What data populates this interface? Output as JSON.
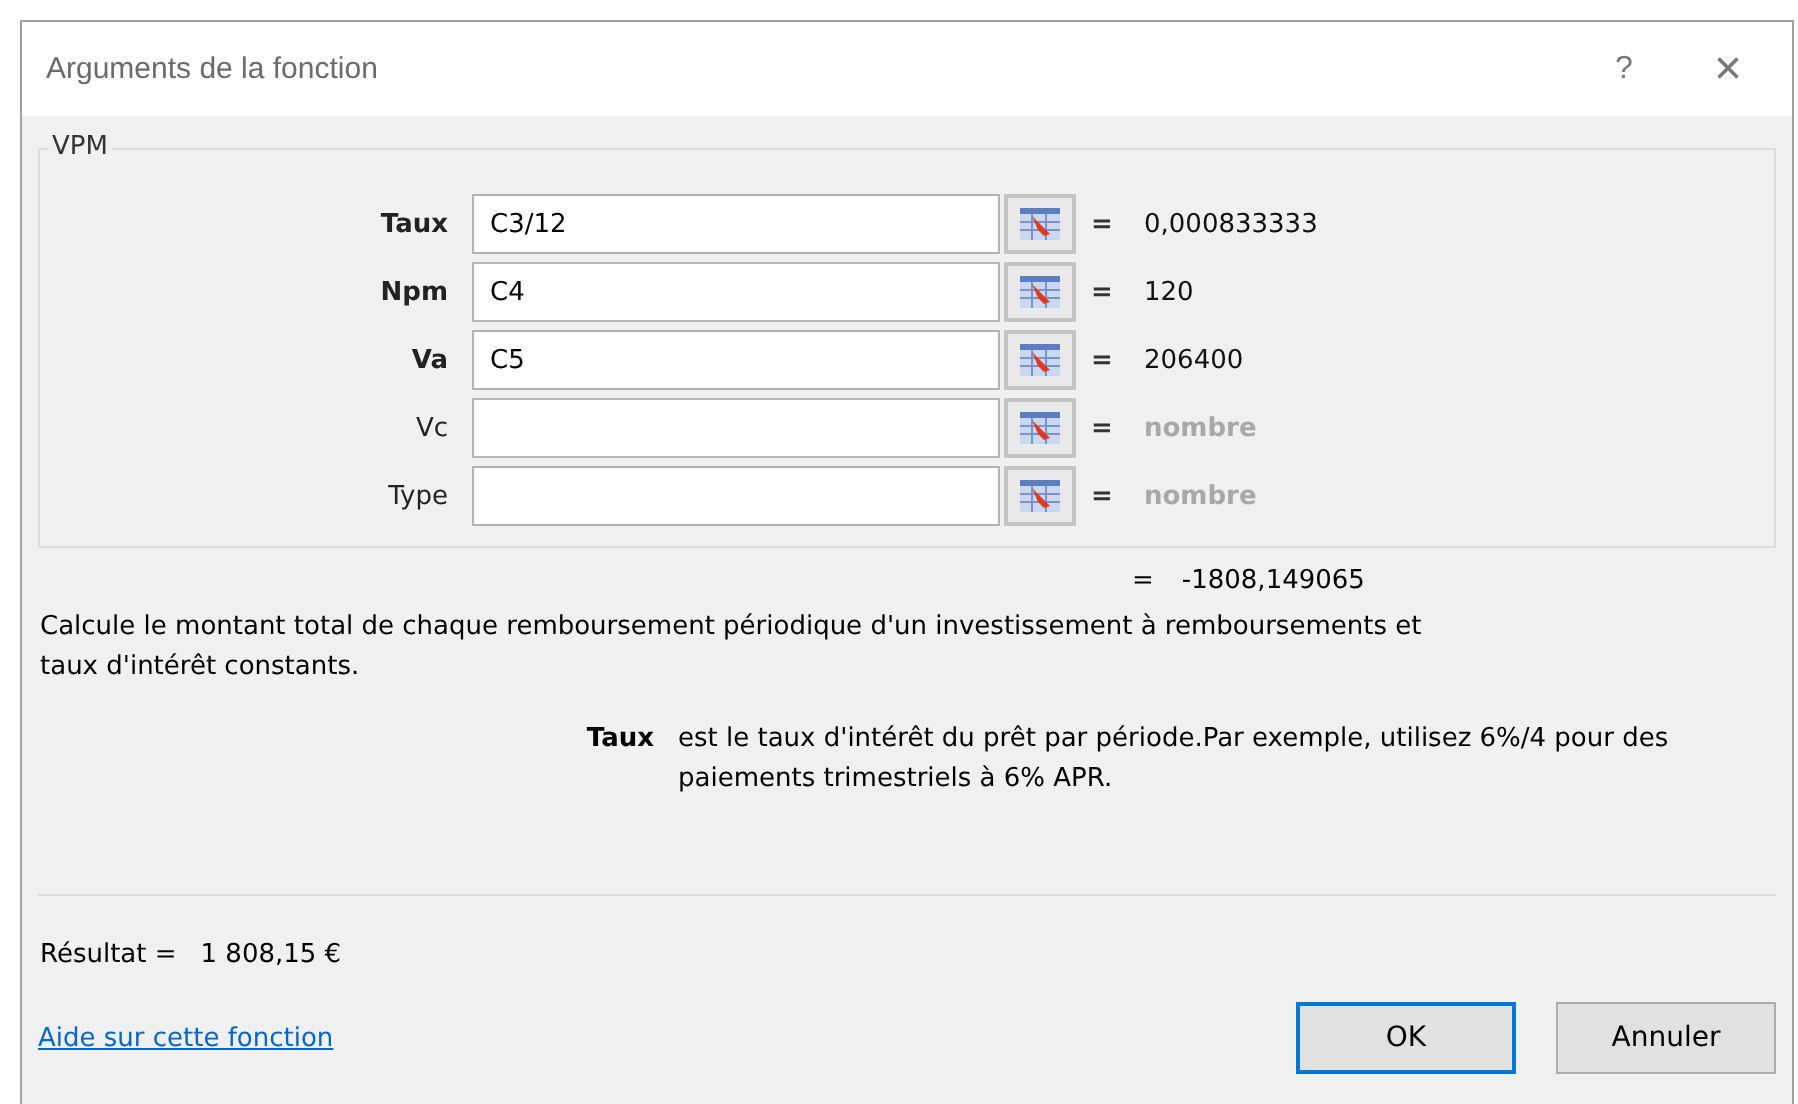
{
  "window": {
    "title": "Arguments de la fonction",
    "help_button": "?",
    "close_button": "×"
  },
  "function_group": {
    "name": "VPM",
    "arguments": [
      {
        "label": "Taux",
        "required": true,
        "value": "C3/12",
        "equals": "=",
        "result": "0,000833333",
        "result_muted": false
      },
      {
        "label": "Npm",
        "required": true,
        "value": "C4",
        "equals": "=",
        "result": "120",
        "result_muted": false
      },
      {
        "label": "Va",
        "required": true,
        "value": "C5",
        "equals": "=",
        "result": "206400",
        "result_muted": false
      },
      {
        "label": "Vc",
        "required": false,
        "equals": "=",
        "result": "nombre",
        "result_muted": true
      },
      {
        "label": "Type",
        "required": false,
        "equals": "=",
        "result": "nombre",
        "result_muted": true
      }
    ]
  },
  "formula_result": {
    "equals": "=",
    "value": "-1808,149065"
  },
  "description": "Calcule le montant total de chaque remboursement périodique d'un investissement à remboursements et taux d'intérêt constants.",
  "argument_help": {
    "label": "Taux",
    "text": "est le taux d'intérêt du prêt par période.Par exemple, utilisez 6%/4 pour des paiements trimestriels à 6% APR."
  },
  "result_line": {
    "label": "Résultat =",
    "value": "1 808,15 €"
  },
  "help_link": "Aide sur cette fonction",
  "buttons": [
    {
      "label": "OK",
      "default": true
    },
    {
      "label": "Annuler",
      "default": false
    }
  ]
}
